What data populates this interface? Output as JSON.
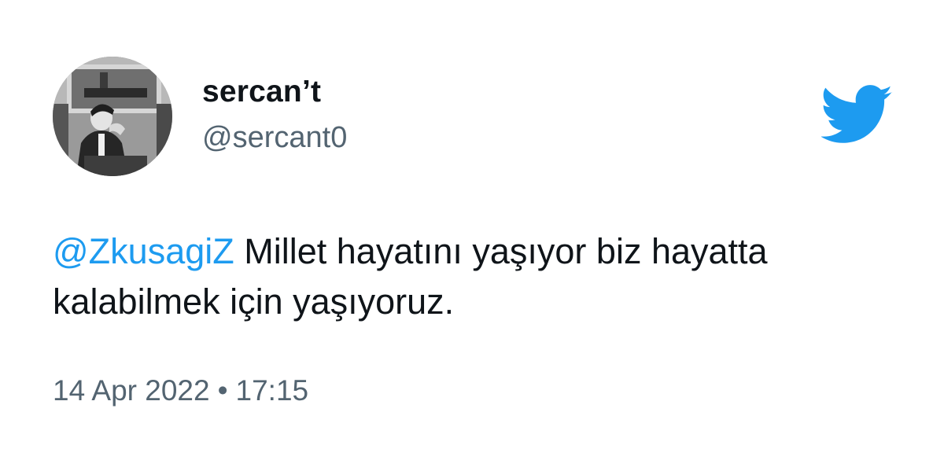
{
  "tweet": {
    "display_name": "sercan’t",
    "handle": "@sercant0",
    "mention": "@ZkusagiZ",
    "text_line1": " Millet hayatını yaşıyor biz hayatta",
    "text_line2": "kalabilmek için yaşıyoruz.",
    "date": "14 Apr 2022",
    "separator": "•",
    "time": "17:15"
  },
  "icons": {
    "logo": "twitter-bird-icon",
    "avatar": "profile-photo"
  },
  "colors": {
    "brand": "#1d9bf0",
    "text_primary": "#0f1419",
    "text_secondary": "#536471",
    "background": "#ffffff"
  }
}
